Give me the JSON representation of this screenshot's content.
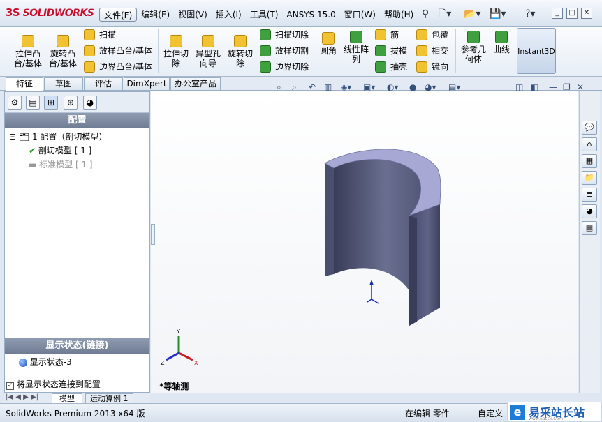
{
  "app": {
    "logo_ds": "3S",
    "logo_text": "SOLIDWORKS"
  },
  "menu": [
    "文件(F)",
    "编辑(E)",
    "视图(V)",
    "插入(I)",
    "工具(T)",
    "ANSYS 15.0",
    "窗口(W)",
    "帮助(H)"
  ],
  "quick_access": [
    "new-icon",
    "open-icon",
    "save-icon",
    "help-icon"
  ],
  "ribbon": {
    "extrude_boss": "拉伸凸\n台/基体",
    "revolve_boss": "旋转凸\n台/基体",
    "sweep": "扫描",
    "loft": "放样凸台/基体",
    "boundary": "边界凸台/基体",
    "extrude_cut": "拉伸切\n除",
    "hole_wizard": "异型孔\n向导",
    "revolve_cut": "旋转切\n除",
    "sweep_cut": "扫描切除",
    "loft_cut": "放样切割",
    "boundary_cut": "边界切除",
    "fillet": "圆角",
    "linear_pattern": "线性阵\n列",
    "rib": "筋",
    "draft": "拔模",
    "shell": "抽壳",
    "wrap": "包覆",
    "intersect": "相交",
    "mirror": "镜向",
    "ref_geometry": "参考几\n何体",
    "curves": "曲线",
    "instant3d": "Instant3D"
  },
  "tabs": [
    "特征",
    "草图",
    "评估",
    "DimXpert",
    "办公室产品"
  ],
  "left_panel": {
    "header": "配置",
    "root": "1 配置（剖切模型）",
    "children": [
      "剖切模型 [ 1 ]",
      "标准模型 [ 1 ]"
    ],
    "display_header": "显示状态(链接)",
    "display_state": "显示状态-3",
    "link_checkbox_label": "将显示状态连接到配置",
    "link_checked": true
  },
  "viewport": {
    "view_label": "*等轴测",
    "axis_labels": {
      "x": "X",
      "y": "Y",
      "z": "Z"
    }
  },
  "bottom_tabs": [
    "模型",
    "运动算例 1"
  ],
  "status": {
    "left": "SolidWorks Premium 2013 x64 版",
    "mid": "在编辑 零件",
    "right": "自定义"
  },
  "watermark": {
    "text": "易采站长站",
    "sub": "www.Easck.Com"
  },
  "colors": {
    "part_face": "#585d78",
    "part_top": "#a7a9d4",
    "accent": "#2c64c8"
  }
}
